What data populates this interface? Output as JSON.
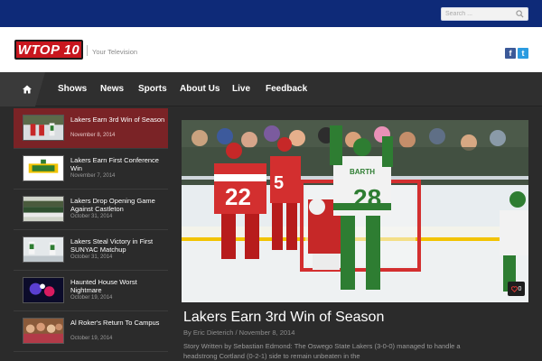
{
  "search": {
    "placeholder": "Search ..."
  },
  "header": {
    "logo_text": "WTOP 10",
    "tagline": "Your Television"
  },
  "social": {
    "facebook": "f",
    "twitter": "t"
  },
  "nav": {
    "items": [
      "Shows",
      "News",
      "Sports",
      "About Us",
      "Live",
      "Feedback"
    ]
  },
  "sidebar": {
    "items": [
      {
        "title": "Lakers Earn 3rd Win of Season",
        "date": "November 8, 2014"
      },
      {
        "title": "Lakers Earn First Conference Win",
        "date": "November 7, 2014"
      },
      {
        "title": "Lakers Drop Opening Game Against Castleton",
        "date": "October 31, 2014"
      },
      {
        "title": "Lakers Steal Victory in First SUNYAC Matchup",
        "date": "October 31, 2014"
      },
      {
        "title": "Haunted House Worst Nightmare",
        "date": "October 19, 2014"
      },
      {
        "title": "Al Roker's Return To Campus",
        "date": "October 19, 2014"
      }
    ]
  },
  "feature": {
    "title": "Lakers Earn 3rd Win of Season",
    "byline": "By Eric Dieterich / November 8, 2014",
    "excerpt": "Story Written by Sebastian Edmond: The Oswego State Lakers (3-0-0) managed to handle a headstrong Cortland (0-2-1) side to remain unbeaten in the",
    "comments": "0",
    "jersey_left": "22",
    "jersey_center": "5",
    "jersey_right": "28",
    "player_name": "BARTH"
  },
  "colors": {
    "topbar": "#0e2a78",
    "active": "#7a2326",
    "logo": "#c8161e"
  }
}
